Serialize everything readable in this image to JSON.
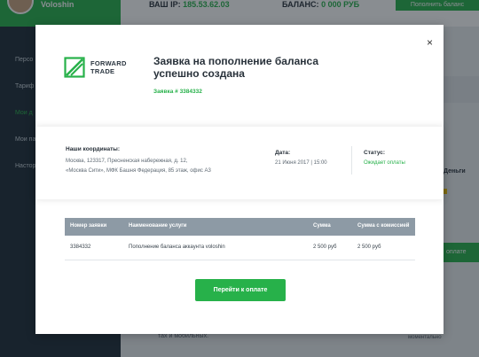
{
  "header": {
    "username": "Voloshin",
    "ip_label": "ВАШ IP:",
    "ip_value": "185.53.62.03",
    "balance_label": "БАЛАНС:",
    "balance_value": "0 000 РУБ",
    "topup_button": "Пополнить баланс"
  },
  "sidebar": {
    "items": [
      {
        "label": "Персо"
      },
      {
        "label": "Тариф"
      },
      {
        "label": "Мои д"
      },
      {
        "label": "Мои па"
      },
      {
        "label": "Настор"
      }
    ]
  },
  "background": {
    "right_label": "Деньги",
    "right_button": "оплате",
    "bottom_text_left": "тах и мобильных.",
    "bottom_text_right": "моментально"
  },
  "modal": {
    "close_symbol": "×",
    "logo_line1": "FORWARD",
    "logo_line2": "TRADE",
    "title": "Заявка на пополнение баланса успешно создана",
    "order_number": "Заявка # 3384332",
    "coords_label": "Наши координаты:",
    "coords_line1": "Москва, 123317, Пресненская набережная, д. 12,",
    "coords_line2": "«Москва Сити», МФК Башня Федерация, 85 этаж, офис А3",
    "date_label": "Дата:",
    "date_value": "21 Июня 2017 | 15:00",
    "status_label": "Статус:",
    "status_value": "Ожидает оплаты",
    "table": {
      "headers": [
        "Номер заявки",
        "Наименование услуги",
        "Сумма",
        "Сумма с комиссией"
      ],
      "rows": [
        [
          "3384332",
          "Пополнение баланса аккаунта voloshin",
          "2 500 руб",
          "2 500 руб"
        ]
      ]
    },
    "pay_button": "Перейти к оплате"
  },
  "colors": {
    "accent": "#27b14a",
    "sidebar_bg": "#1d2b36",
    "table_head": "#8d9aa5"
  }
}
